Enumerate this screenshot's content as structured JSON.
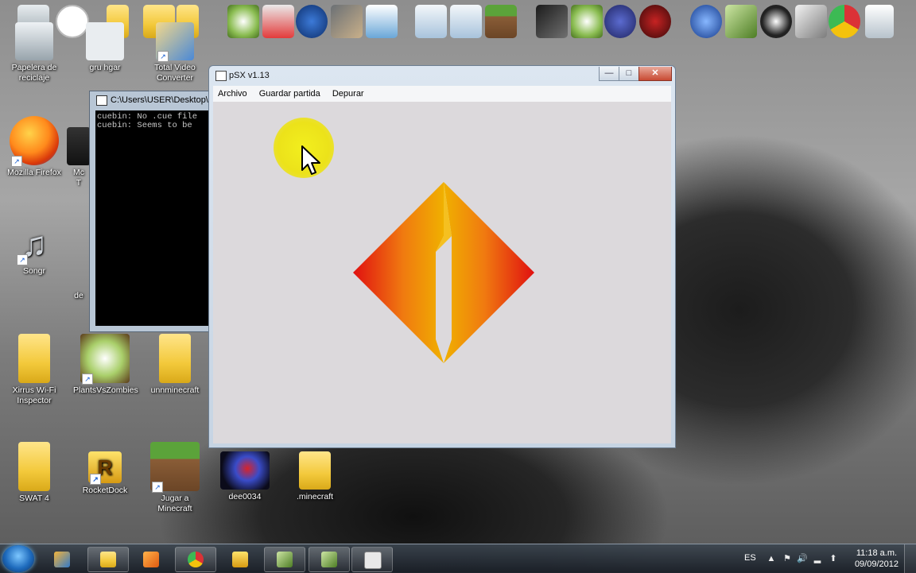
{
  "desktop": {
    "icons": [
      {
        "label": "Papelera de reciclaje"
      },
      {
        "label": "gru hgar"
      },
      {
        "label": "Total Video Converter"
      },
      {
        "label": "Mozilla Firefox"
      },
      {
        "label": "Songr"
      },
      {
        "label": "Xirrus Wi-Fi Inspector"
      },
      {
        "label": "PlantsVsZombies"
      },
      {
        "label": "unnminecraft"
      },
      {
        "label": "SWAT 4"
      },
      {
        "label": "RocketDock"
      },
      {
        "label": "Jugar a Minecraft"
      },
      {
        "label": "dee0034"
      },
      {
        "label": ".minecraft"
      }
    ],
    "partial_labels": {
      "mc": "Mc",
      "t": "T",
      "de": "de"
    }
  },
  "console": {
    "title": "C:\\Users\\USER\\Desktop\\p",
    "lines": [
      "cuebin: No .cue file",
      "cuebin: Seems to be"
    ]
  },
  "psx": {
    "title": "pSX v1.13",
    "menu": [
      "Archivo",
      "Guardar partida",
      "Depurar"
    ],
    "controls": {
      "minimize": "—",
      "maximize": "□",
      "close": "✕"
    }
  },
  "taskbar": {
    "language": "ES",
    "time": "11:18 a.m.",
    "date": "09/09/2012"
  },
  "colors": {
    "highlight": "#f2ef1e",
    "logo_red": "#e01010",
    "logo_orange": "#f07a10",
    "logo_gold": "#f0b000"
  }
}
